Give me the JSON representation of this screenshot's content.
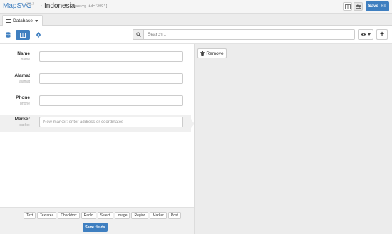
{
  "header": {
    "brand": "MapSVG",
    "version": "3.0.2",
    "arrow": "→",
    "map_title": "Indonesia",
    "shortcode": "[mapsvg id=\"209\"]",
    "save_label": "Save",
    "save_shortcut": "⌘S"
  },
  "tabs": [
    {
      "label": "Database"
    }
  ],
  "toolbar": {
    "search_placeholder": "Search...",
    "add_symbol": "+"
  },
  "form": {
    "rows": [
      {
        "label": "Name",
        "sublabel": "name",
        "value": "",
        "placeholder": ""
      },
      {
        "label": "Alamat",
        "sublabel": "alamat",
        "value": "",
        "placeholder": ""
      },
      {
        "label": "Phone",
        "sublabel": "phone",
        "value": "",
        "placeholder": ""
      },
      {
        "label": "Marker",
        "sublabel": "marker",
        "value": "",
        "placeholder": "New marker: enter address or coordinates"
      }
    ]
  },
  "field_types": [
    "Text",
    "Textarea",
    "Checkbox",
    "Radio",
    "Select",
    "Image",
    "Region",
    "Marker",
    "Post"
  ],
  "save_fields_label": "Save fields",
  "right_panel": {
    "remove_label": "Remove"
  },
  "colors": {
    "accent": "#3f7fc0",
    "panel_gray": "#ececec"
  }
}
